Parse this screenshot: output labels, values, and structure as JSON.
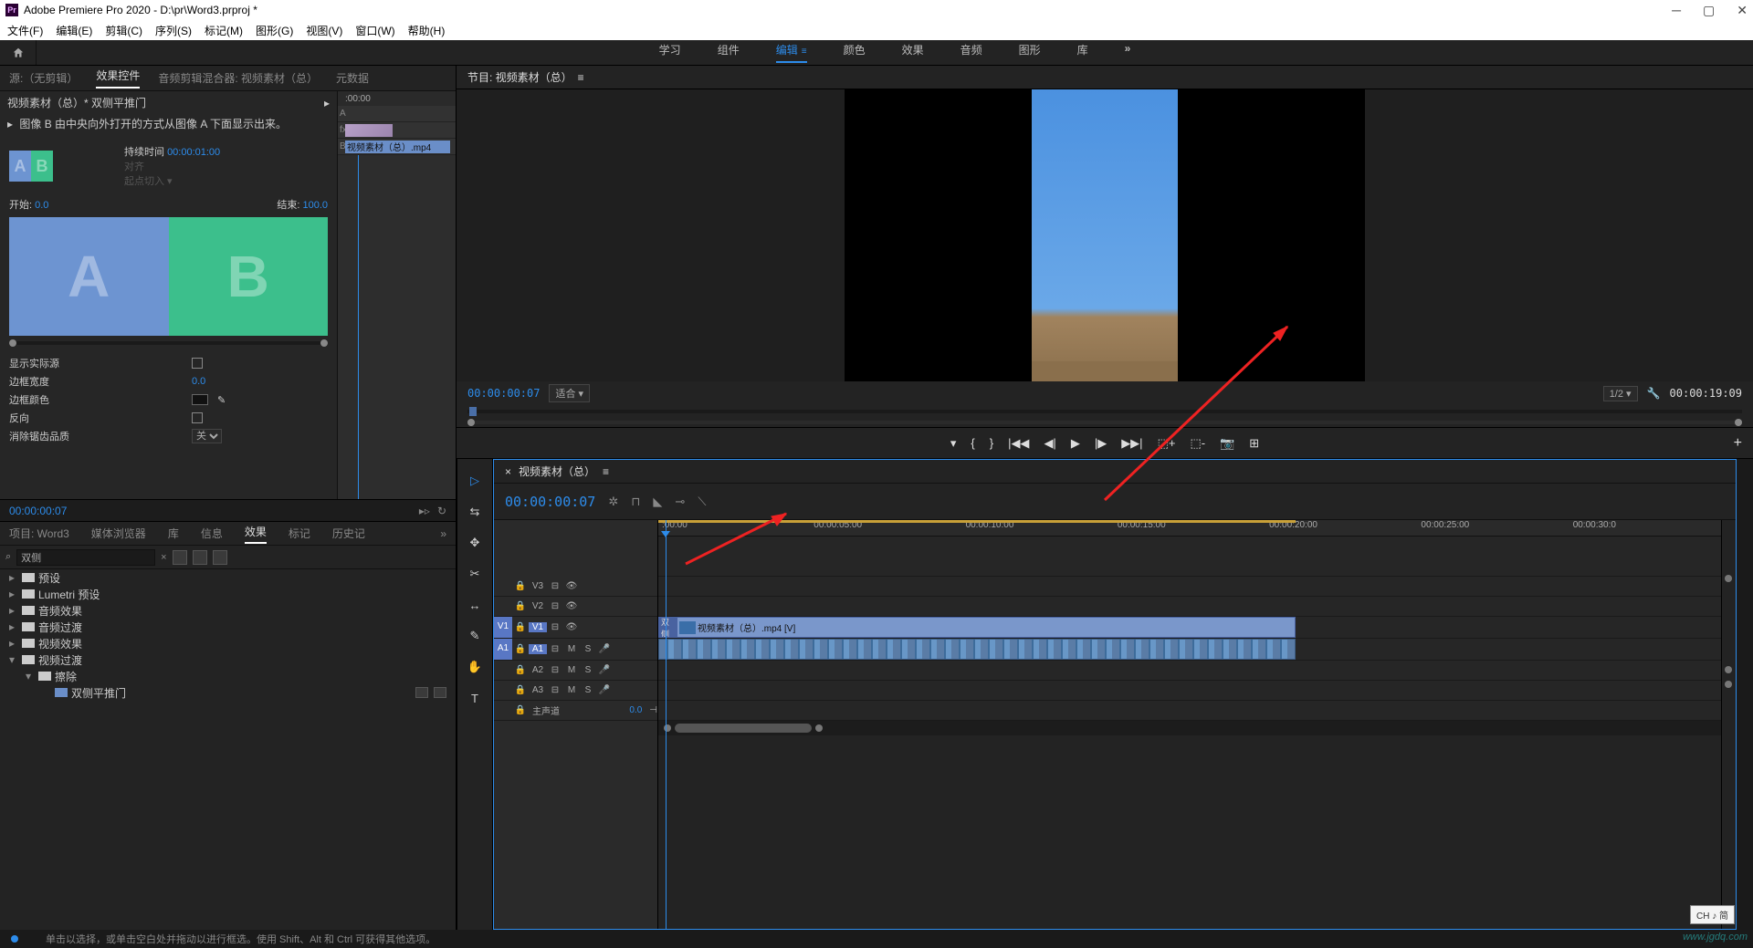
{
  "titlebar": {
    "app_icon": "Pr",
    "title": "Adobe Premiere Pro 2020 - D:\\pr\\Word3.prproj *"
  },
  "menubar": [
    "文件(F)",
    "编辑(E)",
    "剪辑(C)",
    "序列(S)",
    "标记(M)",
    "图形(G)",
    "视图(V)",
    "窗口(W)",
    "帮助(H)"
  ],
  "workspaces": {
    "items": [
      "学习",
      "组件",
      "编辑",
      "颜色",
      "效果",
      "音频",
      "图形",
      "库"
    ],
    "active": "编辑",
    "more": "»"
  },
  "source_tabs": {
    "items": [
      "源:（无剪辑）",
      "效果控件",
      "音频剪辑混合器: 视频素材（总）",
      "元数据"
    ],
    "active": "效果控件",
    "hamburger": "≡"
  },
  "effect_controls": {
    "header": "视频素材（总）* 双侧平推门",
    "description": "图像 B 由中央向外打开的方式从图像 A 下面显示出来。",
    "duration_label": "持续时间",
    "duration_value": "00:00:01:00",
    "align_label": "对齐",
    "align_value": "起点切入",
    "start_label": "开始:",
    "start_value": "0.0",
    "end_label": "结束:",
    "end_value": "100.0",
    "a": "A",
    "b": "B",
    "props": [
      {
        "label": "显示实际源",
        "type": "checkbox"
      },
      {
        "label": "边框宽度",
        "type": "value",
        "value": "0.0"
      },
      {
        "label": "边框颜色",
        "type": "color"
      },
      {
        "label": "反向",
        "type": "checkbox"
      },
      {
        "label": "消除锯齿品质",
        "type": "select",
        "value": "关"
      }
    ],
    "mini_timeline": {
      "ruler": ":00:00",
      "tracks": {
        "a": "A",
        "fx": "fx",
        "b": "B"
      },
      "clip_label": "视频素材（总）.mp4"
    },
    "timecode": "00:00:00:07"
  },
  "project_tabs": {
    "items": [
      "项目: Word3",
      "媒体浏览器",
      "库",
      "信息",
      "效果",
      "标记",
      "历史记"
    ],
    "active": "效果",
    "hamburger": "»"
  },
  "effects_panel": {
    "search_icon": "⌕",
    "search_value": "双侧",
    "clear": "×",
    "tree": [
      {
        "depth": 0,
        "arrow": "▸",
        "icon": "fld",
        "label": "预设"
      },
      {
        "depth": 0,
        "arrow": "▸",
        "icon": "fld",
        "label": "Lumetri 预设"
      },
      {
        "depth": 0,
        "arrow": "▸",
        "icon": "fld",
        "label": "音频效果"
      },
      {
        "depth": 0,
        "arrow": "▸",
        "icon": "fld",
        "label": "音频过渡"
      },
      {
        "depth": 0,
        "arrow": "▸",
        "icon": "fld",
        "label": "视频效果"
      },
      {
        "depth": 0,
        "arrow": "▾",
        "icon": "fld",
        "label": "视频过渡"
      },
      {
        "depth": 1,
        "arrow": "▾",
        "icon": "fld",
        "label": "擦除"
      },
      {
        "depth": 2,
        "arrow": "",
        "icon": "eff",
        "label": "双侧平推门",
        "extra": true
      }
    ]
  },
  "program": {
    "tab": "节目: 视频素材（总）",
    "hamburger": "≡",
    "tc_left": "00:00:00:07",
    "fit": "适合",
    "ratio": "1/2",
    "tc_right": "00:00:19:09",
    "transport": [
      "▾",
      "{",
      "}",
      "|◀◀",
      "◀|",
      "▶",
      "|▶",
      "▶▶|",
      "⬚+",
      "⬚-",
      "📷",
      "⊞"
    ],
    "plus": "+"
  },
  "timeline": {
    "tab": "视频素材（总）",
    "hamburger": "≡",
    "timecode": "00:00:00:07",
    "icons": [
      "✲",
      "⊓",
      "◣",
      "⊸",
      "⟲",
      "⟍"
    ],
    "ruler": [
      ":00:00",
      "00:00:05:00",
      "00:00:10:00",
      "00:00:15:00",
      "00:00:20:00",
      "00:00:25:00",
      "00:00:30:0"
    ],
    "video_tracks": [
      {
        "src": "",
        "tgt": "V3",
        "active": false
      },
      {
        "src": "",
        "tgt": "V2",
        "active": false
      },
      {
        "src": "V1",
        "tgt": "V1",
        "active": true
      }
    ],
    "audio_tracks": [
      {
        "src": "A1",
        "tgt": "A1",
        "active": true
      },
      {
        "src": "",
        "tgt": "A2",
        "active": false
      },
      {
        "src": "",
        "tgt": "A3",
        "active": false
      }
    ],
    "master_label": "主声道",
    "master_value": "0.0",
    "vclip_label": "视频素材（总）.mp4 [V]",
    "vclip_trans": "双侧",
    "tools": [
      "▷",
      "⇆",
      "✥",
      "✂",
      "↔",
      "✎",
      "✋",
      "T"
    ]
  },
  "status": {
    "text": "单击以选择，或单击空白处并拖动以进行框选。使用 Shift、Alt 和 Ctrl 可获得其他选项。"
  },
  "badge": "CH ♪ 简",
  "watermark": "www.jgdq.com"
}
